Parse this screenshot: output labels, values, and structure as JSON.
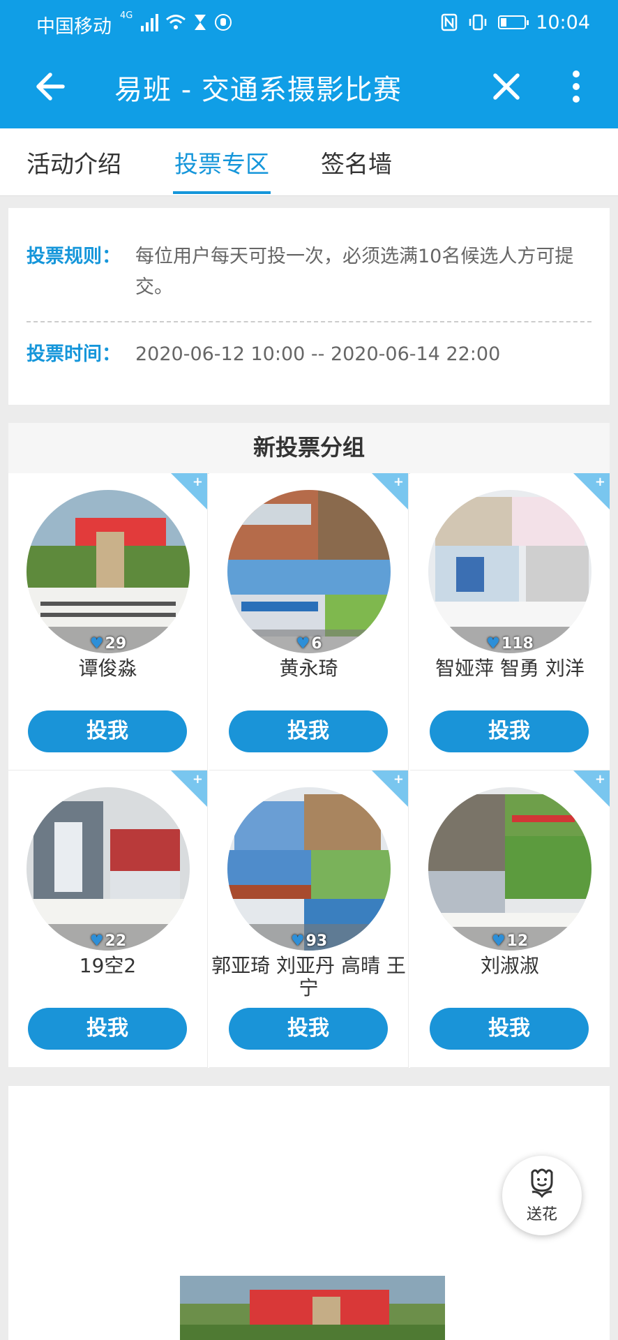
{
  "status_bar": {
    "carrier": "中国移动",
    "network": "4G",
    "time": "10:04"
  },
  "header": {
    "title": "易班 - 交通系摄影比赛"
  },
  "tabs": [
    {
      "label": "活动介绍",
      "active": false
    },
    {
      "label": "投票专区",
      "active": true
    },
    {
      "label": "签名墙",
      "active": false
    }
  ],
  "rules": {
    "rule_label": "投票规则：",
    "rule_text": "每位用户每天可投一次，必须选满10名候选人方可提交。",
    "time_label": "投票时间：",
    "time_text": "2020-06-12 10:00 -- 2020-06-14 22:00"
  },
  "group": {
    "title": "新投票分组",
    "candidates": [
      {
        "name": "谭俊淼",
        "votes": "29",
        "button": "投我"
      },
      {
        "name": "黄永琦",
        "votes": "6",
        "button": "投我"
      },
      {
        "name": "智娅萍 智勇 刘洋",
        "votes": "118",
        "button": "投我"
      },
      {
        "name": "19空2",
        "votes": "22",
        "button": "投我"
      },
      {
        "name": "郭亚琦 刘亚丹 高晴 王宁",
        "votes": "93",
        "button": "投我"
      },
      {
        "name": "刘淑淑",
        "votes": "12",
        "button": "投我"
      }
    ]
  },
  "flower_button": {
    "label": "送花"
  },
  "colors": {
    "primary": "#109ee6",
    "accent": "#1596da",
    "button": "#1a94d8"
  }
}
